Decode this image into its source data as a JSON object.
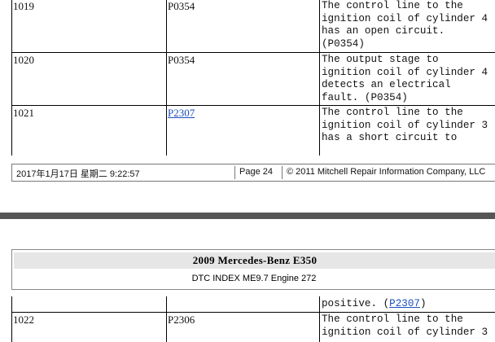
{
  "top_table": {
    "rows": [
      {
        "code": "1019",
        "dtc": "P0354",
        "dtc_link": false,
        "desc": "The control line to the\nignition coil of cylinder 4\nhas an open circuit.\n(P0354)"
      },
      {
        "code": "1020",
        "dtc": "P0354",
        "dtc_link": false,
        "desc": "The output stage to\nignition coil of cylinder 4\ndetects an electrical\nfault. (P0354)"
      },
      {
        "code": "1021",
        "dtc": "P2307",
        "dtc_link": true,
        "desc": "The control line to the\nignition coil of cylinder 3\nhas a short circuit to"
      }
    ]
  },
  "footer": {
    "date": "2017年1月17日 星期二 9:22:57",
    "page": "Page 24",
    "copyright": "© 2011 Mitchell Repair Information Company, LLC"
  },
  "next_page": {
    "title": "2009 Mercedes-Benz E350",
    "subtitle": "DTC INDEX ME9.7 Engine 272",
    "continued_desc_prefix": "positive. (",
    "continued_desc_link": "P2307",
    "continued_desc_suffix": ")",
    "rows": [
      {
        "code": "1022",
        "dtc": "P2306",
        "desc": "The control line to the\nignition coil of cylinder 3"
      }
    ]
  }
}
